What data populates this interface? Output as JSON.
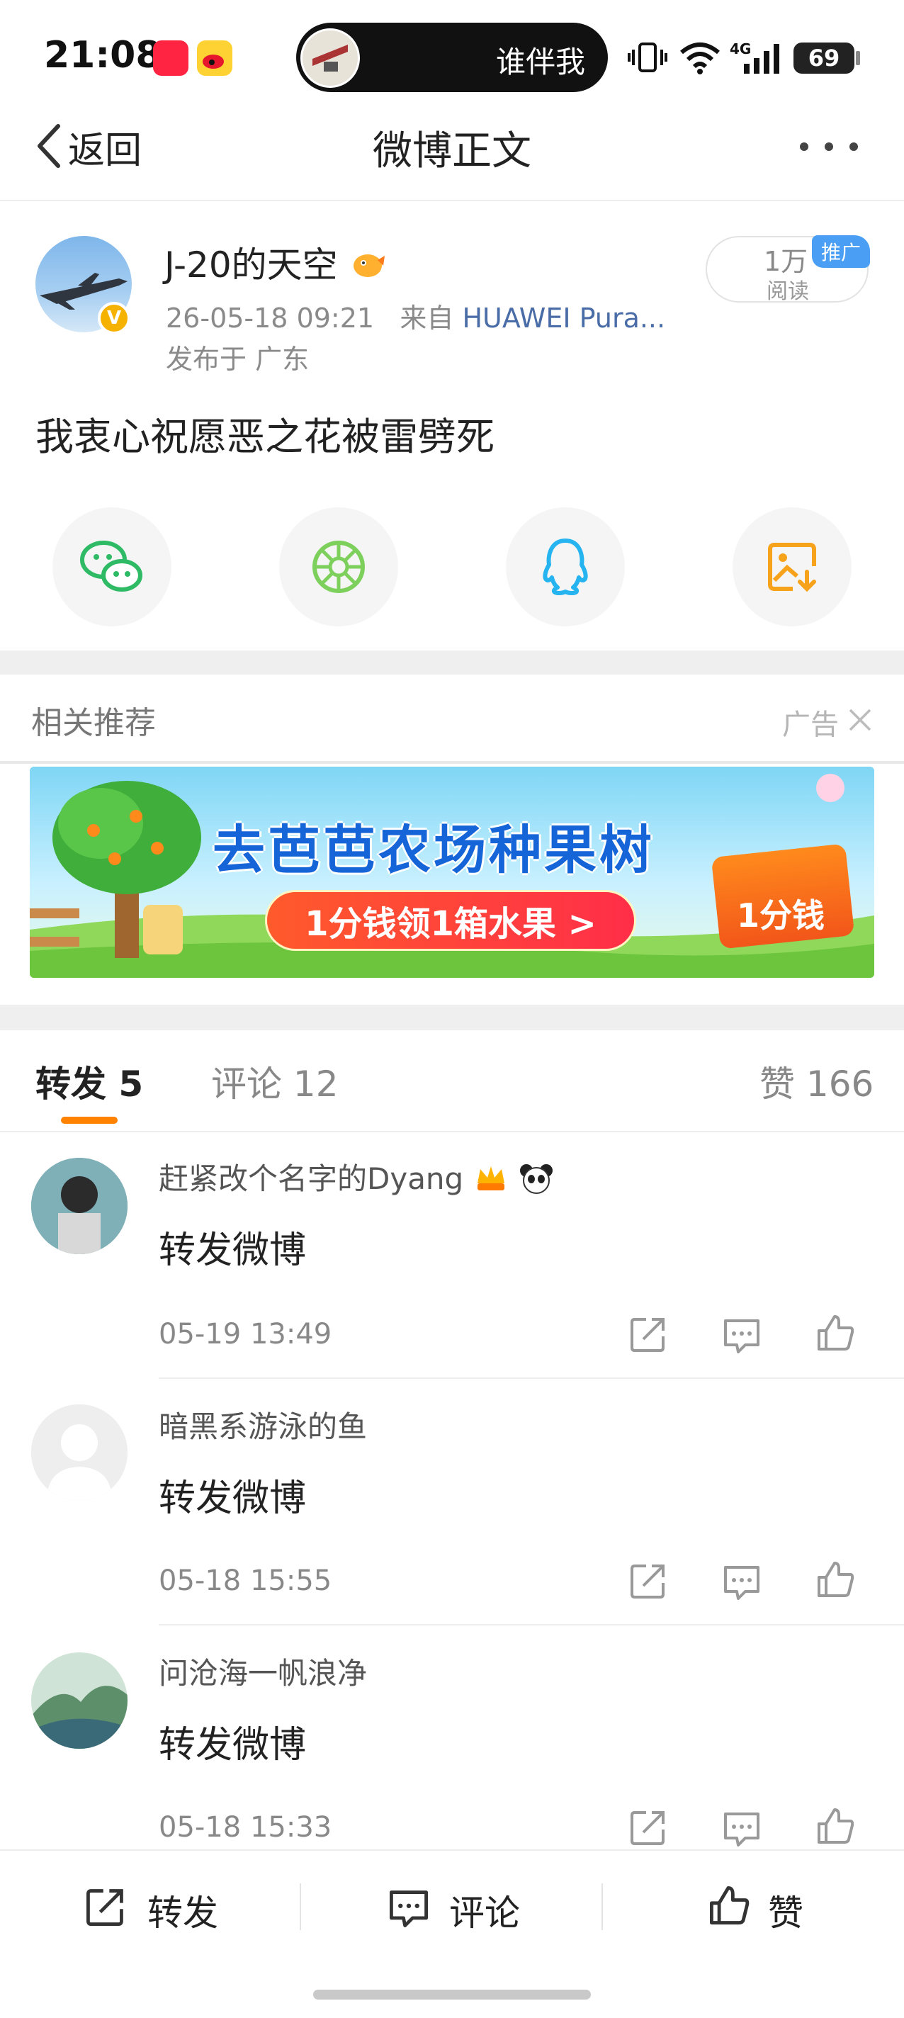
{
  "status_bar": {
    "time": "21:08",
    "app_icons": [
      "xiaohongshu-icon",
      "weibo-icon"
    ],
    "island_text": "谁伴我",
    "battery": "69",
    "network": "4G"
  },
  "nav": {
    "back_label": "返回",
    "title": "微博正文"
  },
  "post": {
    "username": "J-20的天空",
    "timestamp": "26-05-18 09:21",
    "source_prefix": "来自",
    "source": "HUAWEI Pura...",
    "location": "发布于 广东",
    "reads_count": "1万",
    "reads_label": "阅读",
    "promo_badge": "推广",
    "text": "我衷心祝愿恶之花被雷劈死"
  },
  "share_targets": [
    {
      "name": "wechat-icon",
      "color": "#2fba66"
    },
    {
      "name": "moments-icon",
      "color": "#7ed05c"
    },
    {
      "name": "qq-icon",
      "color": "#25b4f0"
    },
    {
      "name": "save-image-icon",
      "color": "#f7a21b"
    }
  ],
  "recommend": {
    "title": "相关推荐",
    "ad_label": "广告",
    "banner_title": "去芭芭农场种果树",
    "banner_cta": "1分钱领1箱水果 >",
    "banner_gift": "1分钱"
  },
  "tabs": {
    "repost": "转发 5",
    "comment": "评论 12",
    "like": "赞 166"
  },
  "reposts": [
    {
      "name": "赶紧改个名字的Dyang",
      "text": "转发微博",
      "time": "05-19 13:49"
    },
    {
      "name": "暗黑系游泳的鱼",
      "text": "转发微博",
      "time": "05-18 15:55"
    },
    {
      "name": "问沧海一帆浪净",
      "text": "转发微博",
      "time": "05-18 15:33"
    }
  ],
  "bottom_bar": {
    "repost": "转发",
    "comment": "评论",
    "like": "赞"
  },
  "colors": {
    "accent": "#ff8200",
    "link": "#4a6da7",
    "divider": "#efefef"
  }
}
